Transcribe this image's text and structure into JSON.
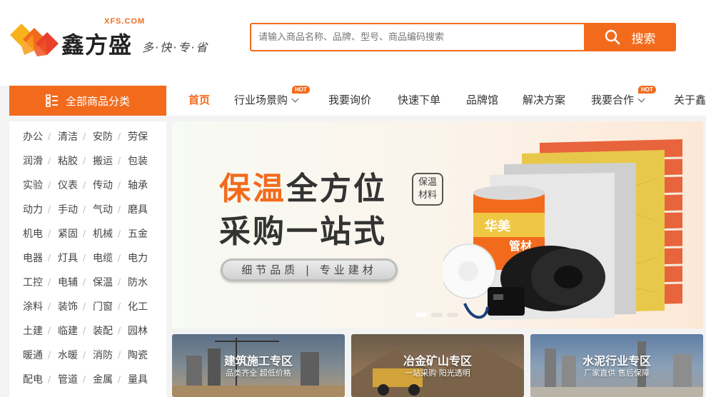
{
  "logo": {
    "domain_mark": "XFS.COM",
    "name": "鑫方盛",
    "slogan": "多·快·专·省"
  },
  "search": {
    "placeholder": "请输入商品名称、品牌、型号、商品编码搜索",
    "button_label": "搜索"
  },
  "category_button": {
    "label": "全部商品分类"
  },
  "nav": {
    "items": [
      {
        "label": "首页",
        "active": true
      },
      {
        "label": "行业场景购",
        "hot": "HOT",
        "dropdown": true
      },
      {
        "label": "我要询价"
      },
      {
        "label": "快速下单"
      },
      {
        "label": "品牌馆"
      },
      {
        "label": "解决方案"
      },
      {
        "label": "我要合作",
        "hot": "HOT",
        "dropdown": true
      },
      {
        "label": "关于鑫"
      }
    ]
  },
  "categories": [
    [
      "办公",
      "清洁",
      "安防",
      "劳保"
    ],
    [
      "润滑",
      "粘胶",
      "搬运",
      "包装"
    ],
    [
      "实验",
      "仪表",
      "传动",
      "轴承"
    ],
    [
      "动力",
      "手动",
      "气动",
      "磨具"
    ],
    [
      "机电",
      "紧固",
      "机械",
      "五金"
    ],
    [
      "电器",
      "灯具",
      "电缆",
      "电力"
    ],
    [
      "工控",
      "电辅",
      "保温",
      "防水"
    ],
    [
      "涂料",
      "装饰",
      "门窗",
      "化工"
    ],
    [
      "土建",
      "临建",
      "装配",
      "园林"
    ],
    [
      "暖通",
      "水暖",
      "消防",
      "陶瓷"
    ],
    [
      "配电",
      "管道",
      "金属",
      "量具"
    ]
  ],
  "category_separator": "/",
  "banner": {
    "title1_highlight": "保温",
    "title1_rest": "全方位",
    "title2": "采购一站式",
    "tag_line1": "保温",
    "tag_line2": "材料",
    "pill": "细节品质 | 专业建材",
    "product_label": "华美",
    "product_label2": "管材"
  },
  "cards": [
    {
      "title": "建筑施工专区",
      "subtitle": "品类齐全  超低价格"
    },
    {
      "title": "冶金矿山专区",
      "subtitle": "一站采购  阳光透明"
    },
    {
      "title": "水泥行业专区",
      "subtitle": "厂家直供  售后保障"
    }
  ],
  "colors": {
    "accent": "#f26b1d",
    "logo_yellow": "#f7b21b",
    "logo_orange": "#f26b1d",
    "logo_red": "#e8402a"
  }
}
